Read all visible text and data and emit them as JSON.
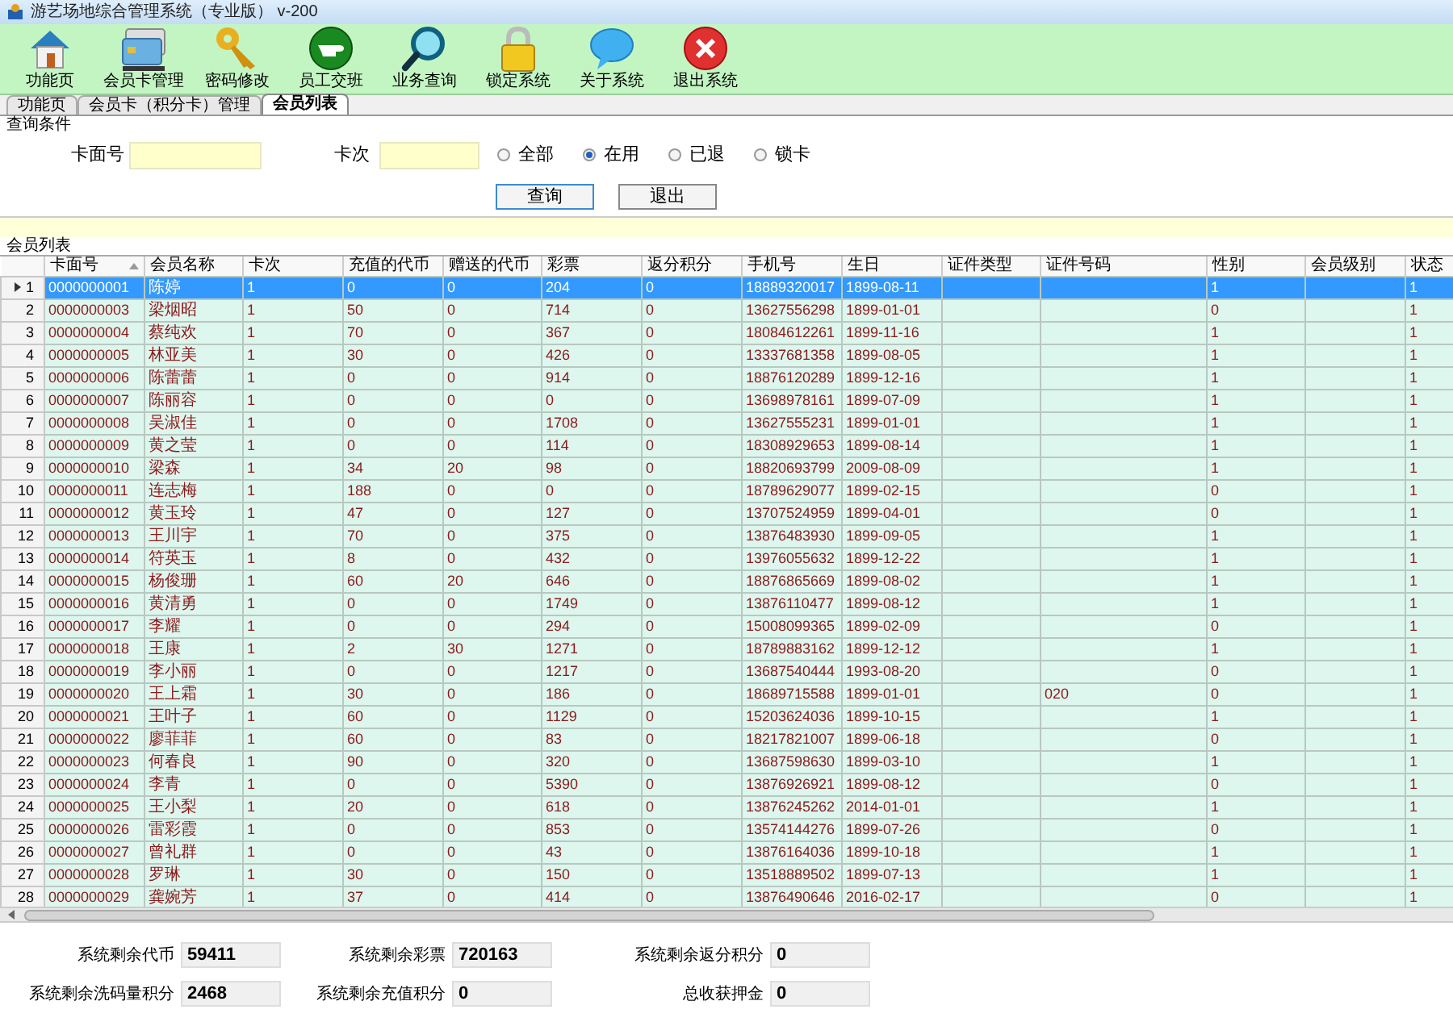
{
  "window": {
    "title": "游艺场地综合管理系统（专业版） v-200"
  },
  "toolbar": [
    {
      "label": "功能页",
      "kind": "home"
    },
    {
      "label": "会员卡管理",
      "kind": "card"
    },
    {
      "label": "密码修改",
      "kind": "key"
    },
    {
      "label": "员工交班",
      "kind": "hand"
    },
    {
      "label": "业务查询",
      "kind": "search"
    },
    {
      "label": "锁定系统",
      "kind": "lock"
    },
    {
      "label": "关于系统",
      "kind": "bubble"
    },
    {
      "label": "退出系统",
      "kind": "exit"
    }
  ],
  "tabs": [
    {
      "label": "功能页",
      "selected": false
    },
    {
      "label": "会员卡（积分卡）管理",
      "selected": false
    },
    {
      "label": "会员列表",
      "selected": true
    }
  ],
  "query": {
    "title": "查询条件",
    "card_label": "卡面号",
    "times_label": "卡次",
    "radios": [
      {
        "label": "全部",
        "selected": false
      },
      {
        "label": "在用",
        "selected": true
      },
      {
        "label": "已退",
        "selected": false
      },
      {
        "label": "锁卡",
        "selected": false
      }
    ],
    "buttons": [
      "查询",
      "退出"
    ]
  },
  "list_title": "会员列表",
  "table": {
    "columns": [
      "卡面号",
      "会员名称",
      "卡次",
      "充值的代币",
      "赠送的代币",
      "彩票",
      "返分积分",
      "手机号",
      "生日",
      "证件类型",
      "证件号码",
      "性别",
      "会员级别",
      "状态"
    ],
    "rows": [
      {
        "number": "1",
        "selected": true,
        "card": "0000000001",
        "name": "陈婷",
        "times": "1",
        "recharge": "0",
        "bonus": "0",
        "tickets": "204",
        "rebate": "0",
        "phone": "18889320017",
        "birthday": "1899-08-11",
        "gender": "1",
        "status": "1"
      },
      {
        "number": "2",
        "selected": false,
        "card": "0000000003",
        "name": "梁烟昭",
        "times": "1",
        "recharge": "50",
        "bonus": "0",
        "tickets": "714",
        "rebate": "0",
        "phone": "13627556298",
        "birthday": "1899-01-01",
        "gender": "0",
        "status": "1"
      },
      {
        "number": "3",
        "selected": false,
        "card": "0000000004",
        "name": "蔡纯欢",
        "times": "1",
        "recharge": "70",
        "bonus": "0",
        "tickets": "367",
        "rebate": "0",
        "phone": "18084612261",
        "birthday": "1899-11-16",
        "gender": "1",
        "status": "1"
      },
      {
        "number": "4",
        "selected": false,
        "card": "0000000005",
        "name": "林亚美",
        "times": "1",
        "recharge": "30",
        "bonus": "0",
        "tickets": "426",
        "rebate": "0",
        "phone": "13337681358",
        "birthday": "1899-08-05",
        "gender": "1",
        "status": "1"
      },
      {
        "number": "5",
        "selected": false,
        "card": "0000000006",
        "name": "陈蕾蕾",
        "times": "1",
        "recharge": "0",
        "bonus": "0",
        "tickets": "914",
        "rebate": "0",
        "phone": "18876120289",
        "birthday": "1899-12-16",
        "gender": "1",
        "status": "1"
      },
      {
        "number": "6",
        "selected": false,
        "card": "0000000007",
        "name": "陈丽容",
        "times": "1",
        "recharge": "0",
        "bonus": "0",
        "tickets": "0",
        "rebate": "0",
        "phone": "13698978161",
        "birthday": "1899-07-09",
        "gender": "1",
        "status": "1"
      },
      {
        "number": "7",
        "selected": false,
        "card": "0000000008",
        "name": "吴淑佳",
        "times": "1",
        "recharge": "0",
        "bonus": "0",
        "tickets": "1708",
        "rebate": "0",
        "phone": "13627555231",
        "birthday": "1899-01-01",
        "gender": "1",
        "status": "1"
      },
      {
        "number": "8",
        "selected": false,
        "card": "0000000009",
        "name": "黄之莹",
        "times": "1",
        "recharge": "0",
        "bonus": "0",
        "tickets": "114",
        "rebate": "0",
        "phone": "18308929653",
        "birthday": "1899-08-14",
        "gender": "1",
        "status": "1"
      },
      {
        "number": "9",
        "selected": false,
        "card": "0000000010",
        "name": "梁森",
        "times": "1",
        "recharge": "34",
        "bonus": "20",
        "tickets": "98",
        "rebate": "0",
        "phone": "18820693799",
        "birthday": "2009-08-09",
        "gender": "1",
        "status": "1"
      },
      {
        "number": "10",
        "selected": false,
        "card": "0000000011",
        "name": "连志梅",
        "times": "1",
        "recharge": "188",
        "bonus": "0",
        "tickets": "0",
        "rebate": "0",
        "phone": "18789629077",
        "birthday": "1899-02-15",
        "gender": "0",
        "status": "1"
      },
      {
        "number": "11",
        "selected": false,
        "card": "0000000012",
        "name": "黄玉玲",
        "times": "1",
        "recharge": "47",
        "bonus": "0",
        "tickets": "127",
        "rebate": "0",
        "phone": "13707524959",
        "birthday": "1899-04-01",
        "gender": "0",
        "status": "1"
      },
      {
        "number": "12",
        "selected": false,
        "card": "0000000013",
        "name": "王川宇",
        "times": "1",
        "recharge": "70",
        "bonus": "0",
        "tickets": "375",
        "rebate": "0",
        "phone": "13876483930",
        "birthday": "1899-09-05",
        "gender": "1",
        "status": "1"
      },
      {
        "number": "13",
        "selected": false,
        "card": "0000000014",
        "name": "符英玉",
        "times": "1",
        "recharge": "8",
        "bonus": "0",
        "tickets": "432",
        "rebate": "0",
        "phone": "13976055632",
        "birthday": "1899-12-22",
        "gender": "1",
        "status": "1"
      },
      {
        "number": "14",
        "selected": false,
        "card": "0000000015",
        "name": "杨俊珊",
        "times": "1",
        "recharge": "60",
        "bonus": "20",
        "tickets": "646",
        "rebate": "0",
        "phone": "18876865669",
        "birthday": "1899-08-02",
        "gender": "1",
        "status": "1"
      },
      {
        "number": "15",
        "selected": false,
        "card": "0000000016",
        "name": "黄清勇",
        "times": "1",
        "recharge": "0",
        "bonus": "0",
        "tickets": "1749",
        "rebate": "0",
        "phone": "13876110477",
        "birthday": "1899-08-12",
        "gender": "1",
        "status": "1"
      },
      {
        "number": "16",
        "selected": false,
        "card": "0000000017",
        "name": "李耀",
        "times": "1",
        "recharge": "0",
        "bonus": "0",
        "tickets": "294",
        "rebate": "0",
        "phone": "15008099365",
        "birthday": "1899-02-09",
        "gender": "0",
        "status": "1"
      },
      {
        "number": "17",
        "selected": false,
        "card": "0000000018",
        "name": "王康",
        "times": "1",
        "recharge": "2",
        "bonus": "30",
        "tickets": "1271",
        "rebate": "0",
        "phone": "18789883162",
        "birthday": "1899-12-12",
        "gender": "1",
        "status": "1"
      },
      {
        "number": "18",
        "selected": false,
        "card": "0000000019",
        "name": "李小丽",
        "times": "1",
        "recharge": "0",
        "bonus": "0",
        "tickets": "1217",
        "rebate": "0",
        "phone": "13687540444",
        "birthday": "1993-08-20",
        "gender": "0",
        "status": "1"
      },
      {
        "number": "19",
        "selected": false,
        "card": "0000000020",
        "name": "王上霜",
        "times": "1",
        "recharge": "30",
        "bonus": "0",
        "tickets": "186",
        "rebate": "0",
        "phone": "18689715588",
        "birthday": "1899-01-01",
        "id_number": "020",
        "gender": "0",
        "status": "1"
      },
      {
        "number": "20",
        "selected": false,
        "card": "0000000021",
        "name": "王叶子",
        "times": "1",
        "recharge": "60",
        "bonus": "0",
        "tickets": "1129",
        "rebate": "0",
        "phone": "15203624036",
        "birthday": "1899-10-15",
        "gender": "1",
        "status": "1"
      },
      {
        "number": "21",
        "selected": false,
        "card": "0000000022",
        "name": "廖菲菲",
        "times": "1",
        "recharge": "60",
        "bonus": "0",
        "tickets": "83",
        "rebate": "0",
        "phone": "18217821007",
        "birthday": "1899-06-18",
        "gender": "0",
        "status": "1"
      },
      {
        "number": "22",
        "selected": false,
        "card": "0000000023",
        "name": "何春良",
        "times": "1",
        "recharge": "90",
        "bonus": "0",
        "tickets": "320",
        "rebate": "0",
        "phone": "13687598630",
        "birthday": "1899-03-10",
        "gender": "1",
        "status": "1"
      },
      {
        "number": "23",
        "selected": false,
        "card": "0000000024",
        "name": "李青",
        "times": "1",
        "recharge": "0",
        "bonus": "0",
        "tickets": "5390",
        "rebate": "0",
        "phone": "13876926921",
        "birthday": "1899-08-12",
        "gender": "0",
        "status": "1"
      },
      {
        "number": "24",
        "selected": false,
        "card": "0000000025",
        "name": "王小梨",
        "times": "1",
        "recharge": "20",
        "bonus": "0",
        "tickets": "618",
        "rebate": "0",
        "phone": "13876245262",
        "birthday": "2014-01-01",
        "gender": "1",
        "status": "1"
      },
      {
        "number": "25",
        "selected": false,
        "card": "0000000026",
        "name": "雷彩霞",
        "times": "1",
        "recharge": "0",
        "bonus": "0",
        "tickets": "853",
        "rebate": "0",
        "phone": "13574144276",
        "birthday": "1899-07-26",
        "gender": "0",
        "status": "1"
      },
      {
        "number": "26",
        "selected": false,
        "card": "0000000027",
        "name": "曾礼群",
        "times": "1",
        "recharge": "0",
        "bonus": "0",
        "tickets": "43",
        "rebate": "0",
        "phone": "13876164036",
        "birthday": "1899-10-18",
        "gender": "1",
        "status": "1"
      },
      {
        "number": "27",
        "selected": false,
        "card": "0000000028",
        "name": "罗琳",
        "times": "1",
        "recharge": "30",
        "bonus": "0",
        "tickets": "150",
        "rebate": "0",
        "phone": "13518889502",
        "birthday": "1899-07-13",
        "gender": "1",
        "status": "1"
      },
      {
        "number": "28",
        "selected": false,
        "card": "0000000029",
        "name": "龚婉芳",
        "times": "1",
        "recharge": "37",
        "bonus": "0",
        "tickets": "414",
        "rebate": "0",
        "phone": "13876490646",
        "birthday": "2016-02-17",
        "gender": "0",
        "status": "1"
      }
    ]
  },
  "stats": [
    {
      "label": "系统剩余代币",
      "value": "59411"
    },
    {
      "label": "系统剩余彩票",
      "value": "720163"
    },
    {
      "label": "系统剩余返分积分",
      "value": "0"
    },
    {
      "label": "系统剩余洗码量积分",
      "value": "2468"
    },
    {
      "label": "系统剩余充值积分",
      "value": "0"
    },
    {
      "label": "总收获押金",
      "value": "0"
    }
  ]
}
